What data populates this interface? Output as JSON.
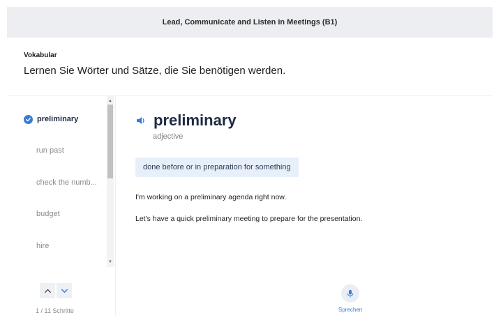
{
  "course": {
    "title": "Lead, Communicate and Listen in Meetings (B1)"
  },
  "section": {
    "kicker": "Vokabular",
    "headline": "Lernen Sie Wörter und Sätze, die Sie benötigen werden."
  },
  "sidebar": {
    "items": [
      {
        "label": "preliminary",
        "active": true
      },
      {
        "label": "run past",
        "active": false
      },
      {
        "label": "check the numb...",
        "active": false
      },
      {
        "label": "budget",
        "active": false
      },
      {
        "label": "hire",
        "active": false
      }
    ],
    "steps_text": "1 / 11 Schritte"
  },
  "card": {
    "word": "preliminary",
    "part_of_speech": "adjective",
    "definition": "done before or in preparation for something",
    "examples": [
      "I'm working on a preliminary agenda right now.",
      "Let's have a quick preliminary meeting to prepare for the presentation."
    ]
  },
  "speak": {
    "label": "Sprechen"
  },
  "icons": {
    "check": "check-circle-icon",
    "speaker": "speaker-icon",
    "up": "chevron-up-icon",
    "down": "chevron-down-icon",
    "mic": "microphone-icon"
  },
  "colors": {
    "accent": "#3a7bd5",
    "definition_bg": "#e7f0fa",
    "topbar_bg": "#eceef1"
  }
}
